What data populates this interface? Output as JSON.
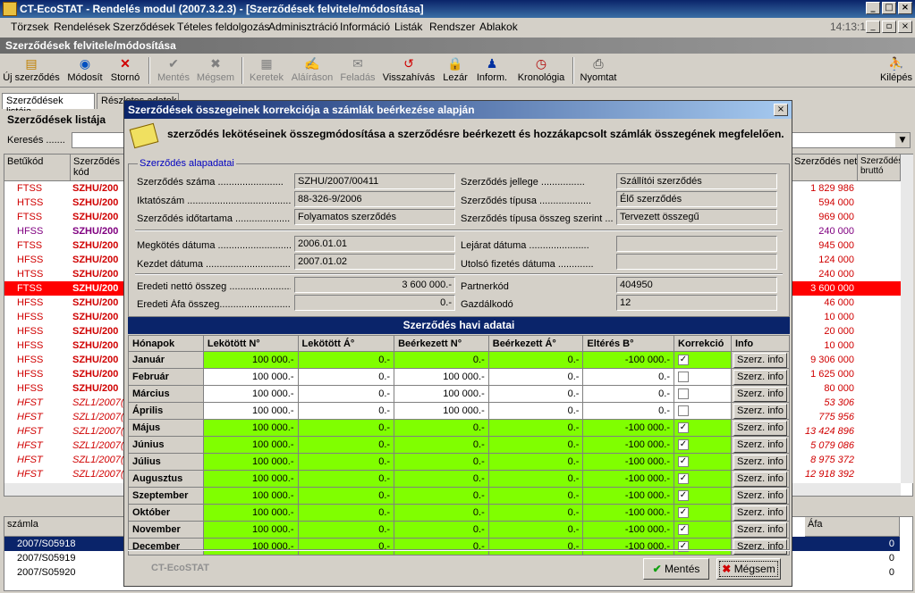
{
  "window": {
    "title": "CT-EcoSTAT - Rendelés modul (2007.3.2.3) - [Szerződések felvitele/módosítása]",
    "clock": "14:13:10"
  },
  "menu": [
    "Törzsek",
    "Rendelések",
    "Szerződések",
    "Tételes feldolgozás",
    "Adminisztráció",
    "Információ",
    "Listák",
    "Rendszer",
    "Ablakok"
  ],
  "section_title": "Szerződések felvitele/módosítása",
  "toolbar": [
    {
      "label": "Új szerződés",
      "icon": "new-icon"
    },
    {
      "label": "Módosít",
      "icon": "edit-icon"
    },
    {
      "label": "Stornó",
      "icon": "storno-icon"
    },
    {
      "label": "Mentés",
      "icon": "check-icon"
    },
    {
      "label": "Mégsem",
      "icon": "x-icon"
    },
    {
      "label": "Keretek",
      "icon": "frame-icon"
    },
    {
      "label": "Aláíráson",
      "icon": "sign-icon"
    },
    {
      "label": "Feladás",
      "icon": "send-icon"
    },
    {
      "label": "Visszahívás",
      "icon": "recall-icon"
    },
    {
      "label": "Lezár",
      "icon": "lock-icon"
    },
    {
      "label": "Inform.",
      "icon": "info-icon"
    },
    {
      "label": "Kronológia",
      "icon": "clock-icon"
    },
    {
      "label": "Nyomtat",
      "icon": "printer-icon"
    },
    {
      "label": "Kilépés",
      "icon": "exit-icon"
    }
  ],
  "tabs": [
    "Szerződések listája",
    "Részletes adatok"
  ],
  "list": {
    "title": "Szerződések listája",
    "search_label": "Keresés .......",
    "columns": [
      "Betűkód",
      "Szerződés kód",
      "Szerződés nettó",
      "Szerződés bruttó"
    ],
    "rows": [
      {
        "b": "FTSS",
        "k": "SZHU/200",
        "n": "1 829 986"
      },
      {
        "b": "HTSS",
        "k": "SZHU/200",
        "n": "594 000"
      },
      {
        "b": "FTSS",
        "k": "SZHU/200",
        "n": "969 000"
      },
      {
        "b": "HFSS",
        "k": "SZHU/200",
        "n": "240 000"
      },
      {
        "b": "FTSS",
        "k": "SZHU/200",
        "n": "945 000"
      },
      {
        "b": "HFSS",
        "k": "SZHU/200",
        "n": "124 000"
      },
      {
        "b": "HTSS",
        "k": "SZHU/200",
        "n": "240 000"
      },
      {
        "b": "FTSS",
        "k": "SZHU/200",
        "n": "3 600 000"
      },
      {
        "b": "HFSS",
        "k": "SZHU/200",
        "n": "46 000"
      },
      {
        "b": "HFSS",
        "k": "SZHU/200",
        "n": "10 000"
      },
      {
        "b": "HFSS",
        "k": "SZHU/200",
        "n": "20 000"
      },
      {
        "b": "HFSS",
        "k": "SZHU/200",
        "n": "10 000"
      },
      {
        "b": "HFSS",
        "k": "SZHU/200",
        "n": "9 306 000"
      },
      {
        "b": "HFSS",
        "k": "SZHU/200",
        "n": "1 625 000"
      },
      {
        "b": "HFSS",
        "k": "SZHU/200",
        "n": "80 000"
      },
      {
        "b": "HFST",
        "k": "SZL1/2007(",
        "n": "53 306"
      },
      {
        "b": "HFST",
        "k": "SZL1/2007(",
        "n": "775 956"
      },
      {
        "b": "HFST",
        "k": "SZL1/2007(",
        "n": "13 424 896"
      },
      {
        "b": "HFST",
        "k": "SZL1/2007(",
        "n": "5 079 086"
      },
      {
        "b": "HFST",
        "k": "SZL1/2007(",
        "n": "8 975 372"
      },
      {
        "b": "HFST",
        "k": "SZL1/2007(",
        "n": "12 918 392"
      }
    ]
  },
  "invoices": {
    "col_left": "számla",
    "col_right": "Áfa",
    "rows": [
      "2007/S05918",
      "2007/S05919",
      "2007/S05920"
    ],
    "afa": [
      "0",
      "0",
      "0"
    ]
  },
  "dialog": {
    "title": "Szerződések összegeinek korrekciója a számlák beérkezése alapján",
    "description": "szerződés lekötéseinek összegmódosítása a szerződésre beérkezett és hozzákapcsolt számlák összegének megfelelően.",
    "group_title": "Szerződés alapadatai",
    "fields_left": [
      {
        "label": "Szerződés száma ........................",
        "value": "SZHU/2007/00411"
      },
      {
        "label": "Iktatószám ........................................",
        "value": "88-326-9/2006"
      },
      {
        "label": "Szerződés időtartama ......................",
        "value": "Folyamatos szerződés"
      },
      {
        "label": "Megkötés dátuma ............................",
        "value": "2006.01.01"
      },
      {
        "label": "Kezdet dátuma ...............................",
        "value": "2007.01.02"
      },
      {
        "label": "Eredeti nettó összeg .......................",
        "value": "3 600 000.-"
      },
      {
        "label": "Eredeti Áfa összeg.............................",
        "value": "0.-"
      }
    ],
    "fields_right": [
      {
        "label": "Szerződés jellege ................",
        "value": "Szállítói szerződés"
      },
      {
        "label": "Szerződés típusa ...................",
        "value": "Élő szerződés"
      },
      {
        "label": "Szerződés típusa összeg szerint ...",
        "value": "Tervezett összegű"
      },
      {
        "label": "Lejárat dátuma ......................",
        "value": ""
      },
      {
        "label": "Utolsó fizetés dátuma .............",
        "value": ""
      },
      {
        "label": "Partnerkód",
        "value": "404950"
      },
      {
        "label": "Gazdálkodó",
        "value": "12"
      }
    ],
    "monthly_title": "Szerződés havi adatai",
    "columns": [
      "Hónapok",
      "Lekötött N°",
      "Lekötött Á°",
      "Beérkezett N°",
      "Beérkezett Á°",
      "Eltérés B°",
      "Korrekció",
      "Info"
    ],
    "months": [
      {
        "m": "Január",
        "ln": "100 000.-",
        "la": "0.-",
        "bn": "0.-",
        "ba": "0.-",
        "e": "-100 000.-",
        "k": "✓",
        "g": true
      },
      {
        "m": "Február",
        "ln": "100 000.-",
        "la": "0.-",
        "bn": "100 000.-",
        "ba": "0.-",
        "e": "0.-",
        "k": "",
        "g": false
      },
      {
        "m": "Március",
        "ln": "100 000.-",
        "la": "0.-",
        "bn": "100 000.-",
        "ba": "0.-",
        "e": "0.-",
        "k": "",
        "g": false
      },
      {
        "m": "Április",
        "ln": "100 000.-",
        "la": "0.-",
        "bn": "100 000.-",
        "ba": "0.-",
        "e": "0.-",
        "k": "",
        "g": false
      },
      {
        "m": "Május",
        "ln": "100 000.-",
        "la": "0.-",
        "bn": "0.-",
        "ba": "0.-",
        "e": "-100 000.-",
        "k": "✓",
        "g": true
      },
      {
        "m": "Június",
        "ln": "100 000.-",
        "la": "0.-",
        "bn": "0.-",
        "ba": "0.-",
        "e": "-100 000.-",
        "k": "✓",
        "g": true
      },
      {
        "m": "Július",
        "ln": "100 000.-",
        "la": "0.-",
        "bn": "0.-",
        "ba": "0.-",
        "e": "-100 000.-",
        "k": "✓",
        "g": true
      },
      {
        "m": "Augusztus",
        "ln": "100 000.-",
        "la": "0.-",
        "bn": "0.-",
        "ba": "0.-",
        "e": "-100 000.-",
        "k": "✓",
        "g": true
      },
      {
        "m": "Szeptember",
        "ln": "100 000.-",
        "la": "0.-",
        "bn": "0.-",
        "ba": "0.-",
        "e": "-100 000.-",
        "k": "✓",
        "g": true
      },
      {
        "m": "Október",
        "ln": "100 000.-",
        "la": "0.-",
        "bn": "0.-",
        "ba": "0.-",
        "e": "-100 000.-",
        "k": "✓",
        "g": true
      },
      {
        "m": "November",
        "ln": "100 000.-",
        "la": "0.-",
        "bn": "0.-",
        "ba": "0.-",
        "e": "-100 000.-",
        "k": "✓",
        "g": true
      },
      {
        "m": "December",
        "ln": "100 000.-",
        "la": "0.-",
        "bn": "0.-",
        "ba": "0.-",
        "e": "-100 000.-",
        "k": "✓",
        "g": true
      }
    ],
    "info_button": "Szerz. info",
    "brand": "CT-EcoSTAT",
    "save": "Mentés",
    "cancel": "Mégsem"
  }
}
